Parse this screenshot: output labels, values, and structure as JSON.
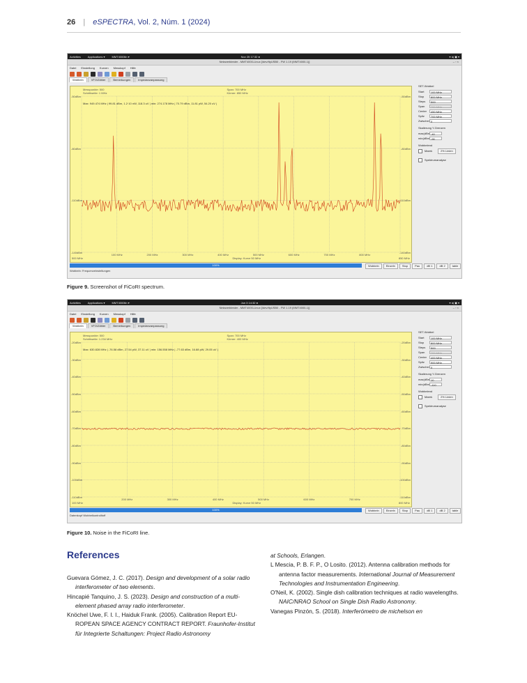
{
  "header": {
    "page_number": "26",
    "separator": "|",
    "journal": "eSPECTRA",
    "volume": ", Vol. 2, Núm. 1 (2024)"
  },
  "screenshots": [
    {
      "topbar": {
        "activities": "Activities",
        "applications": "Applications ▾",
        "app": "MMT4000lin ▾",
        "clock": "Nov 25 17:32 ●",
        "sys": "▾ ◂) ▣ ▾"
      },
      "window_title": "Netzwerktester - MMT4000-Linux [/dev/ttyUSB0 - FW 1.19 (MMT4000-1)]",
      "window_controls": "–  ▫  ×",
      "menu": [
        "Datei",
        "Einstellung",
        "Kurven",
        "Messkopf",
        "Hilfe"
      ],
      "tabs": [
        "Wobbeln",
        "VFO/Zähler",
        "Bemerkungen",
        "Impedanzanpassung"
      ],
      "plot_info_left": [
        "Messpunkte: 500",
        "Schrittweite: 1 MHz"
      ],
      "plot_info_center": [
        "Span: 700 MHz",
        "Körner: 850 MHz"
      ],
      "max_readout": "Max: 949.474 MHz | 99.81 dBm, 1.2·10 nW, 118.3 uV | min: 274.178 MHz | 70.79 dBm, 11.81 pW, 54.20 uV |",
      "y_ticks": [
        "-50dBm",
        "-80dBm",
        "-110dBm",
        "-140dBm"
      ],
      "x_ticks": [
        "100 MHz",
        "200 MHz",
        "300 MHz",
        "400 MHz",
        "500 MHz",
        "600 MHz",
        "700 MHz",
        "800 MHz"
      ],
      "x_start": "500 MHz",
      "x_end": "850 MHz",
      "display_note": "Display: Kurve 50 MHz",
      "status": "100%",
      "buttons": [
        "Wobbeln",
        "Einzeln",
        "Stop",
        "Pau",
        "dB 1",
        "dB 2",
        "table"
      ],
      "footer": "Wobbeln: Frequenzeinstellungen",
      "side": {
        "title": "SET-Wobbel",
        "fields": [
          {
            "label": "Start",
            "value": "100 MHz",
            "disabled": false
          },
          {
            "label": "Stop",
            "value": "800 MHz",
            "disabled": false
          },
          {
            "label": "Steps",
            "value": "500",
            "disabled": false
          },
          {
            "label": "Span",
            "value": "700 MHz",
            "disabled": true
          },
          {
            "label": "Center",
            "value": "450 MHz",
            "disabled": false
          },
          {
            "label": "Spitz",
            "value": "700 MHz",
            "disabled": false
          },
          {
            "label": "Zwischenzeit",
            "value": "0",
            "disabled": false
          }
        ],
        "scale_title": "Skalierung Y-Grenzen",
        "scale_fields": [
          {
            "label": "max(dBm)",
            "value": "-40"
          },
          {
            "label": "min(dBm)",
            "value": "-90"
          }
        ],
        "wobble_title": "Wobbelend",
        "marker": "Marek",
        "marker_btn": "2% Linien",
        "check": "Spektrumanalyse"
      }
    },
    {
      "topbar": {
        "activities": "Activities",
        "applications": "Applications ▾",
        "app": "MMT4000lin ▾",
        "clock": "Jun 3 14:32 ●",
        "sys": "▾ ◂) ▣ ▾"
      },
      "window_title": "Netzwerktester - MMT4000-Linux [/dev/ttyUSB0 - FW 1.19 (MMT4000-1)]",
      "window_controls": "–  ▫  ×",
      "menu": [
        "Datei",
        "Einstellung",
        "Kurven",
        "Messkopf",
        "Hilfe"
      ],
      "tabs": [
        "Wobbeln",
        "VFO/Zähler",
        "Bemerkungen",
        "Impedanzanpassung"
      ],
      "plot_info_left": [
        "Messpunkte: 500",
        "Schrittweite: 1.234 MHz"
      ],
      "plot_info_center": [
        "Span: 700 MHz",
        "Körner: 400 MHz"
      ],
      "max_readout": "Max: 630.828 MHz | -76.58 dBm, 27.54 pW, 37.11 uV | min: 156.558 MHz | -77.63 dBm, 16.88 pW, 29.05 uV |",
      "y_ticks": [
        "-20dBm",
        "-30dBm",
        "-40dBm",
        "-50dBm",
        "-60dBm",
        "-70dBm",
        "-80dBm",
        "-90dBm",
        "-100dBm",
        "-110dBm"
      ],
      "x_ticks": [
        "200 MHz",
        "300 MHz",
        "400 MHz",
        "500 MHz",
        "600 MHz",
        "700 MHz"
      ],
      "x_start": "100 MHz",
      "x_end": "800 MHz",
      "display_note": "Display: Kurve 50 MHz",
      "status": "100%",
      "buttons": [
        "Wobbeln",
        "Einzeln",
        "Stop",
        "Pau",
        "dB 1",
        "dB 2",
        "table"
      ],
      "footer": "Datenkopf Wobbelkontrolltoff",
      "side": {
        "title": "SET-Wobbel",
        "fields": [
          {
            "label": "Start",
            "value": "100 MHz",
            "disabled": false
          },
          {
            "label": "Stop",
            "value": "800 MHz",
            "disabled": false
          },
          {
            "label": "Steps",
            "value": "500",
            "disabled": false
          },
          {
            "label": "Span",
            "value": "700 MHz",
            "disabled": true
          },
          {
            "label": "Center",
            "value": "400 MHz",
            "disabled": false
          },
          {
            "label": "Spitz",
            "value": "900 MHz",
            "disabled": false
          },
          {
            "label": "Zwischenzeit",
            "value": "0",
            "disabled": false
          }
        ],
        "scale_title": "Skalierung Y-Grenzen",
        "scale_fields": [
          {
            "label": "max(dBm)",
            "value": "10"
          },
          {
            "label": "min(dBm)",
            "value": "-110"
          }
        ],
        "wobble_title": "Wobbelend",
        "marker": "Marek",
        "marker_btn": "2% Linien",
        "check": "Spektrumanalyse"
      }
    }
  ],
  "captions": {
    "fig9": {
      "label": "Figure 9.",
      "text": " Screenshot of FiCoRI spectrum."
    },
    "fig10": {
      "label": "Figure 10.",
      "text": " Noise in the FiCoRI line."
    }
  },
  "references": {
    "title": "References",
    "left": [
      {
        "plain": "Guevara Gómez, J. C. (2017). ",
        "italic": "Design and development of a solar radio interferometer of two elements",
        "tail": "."
      },
      {
        "plain": "Hincapié Tanquino, J. S. (2023). ",
        "italic": "Design and construction of a multi-element phased array radio interferometer",
        "tail": "."
      },
      {
        "plain": "Knöchel Uwe, F. I. I., Haiduk Frank. (2005). Calibration Report EU-ROPEAN SPACE AGENCY CONTRACT REPORT. ",
        "italic": "Fraunhofer-Institut für Integrierte Schaltungen: Project Radio Astronomy",
        "tail": ""
      }
    ],
    "right": [
      {
        "plain": "",
        "italic": "at Schools, Erlangen",
        "tail": "."
      },
      {
        "plain": "L Mescia, P. B. F. P., O Losito. (2012). Antenna calibration methods for antenna factor measurements. ",
        "italic": "International Journal of Measurement Technologies and Instrumentation Engineering",
        "tail": "."
      },
      {
        "plain": "O'Neil, K. (2002). Single dish calibration techniques at radio wavelengths. ",
        "italic": "NAIC/NRAO School on Single Dish Radio Astronomy",
        "tail": "."
      },
      {
        "plain": "Vanegas Pinzón, S. (2018). ",
        "italic": "Interferómetro de michelson en",
        "tail": ""
      }
    ]
  }
}
